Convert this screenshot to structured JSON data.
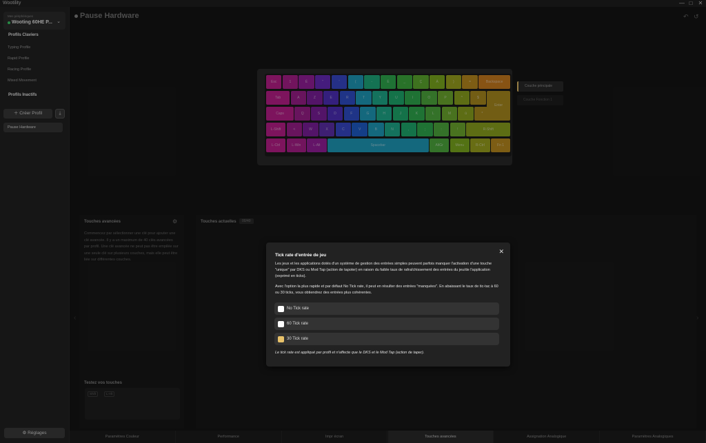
{
  "window": {
    "title": "Wootility",
    "controls": [
      "—",
      "□",
      "✕"
    ]
  },
  "sidebar": {
    "device_label": "Mes périphériques",
    "device_name": "Wooting 60HE P...",
    "keyboard_profiles_title": "Profils Claviers",
    "profiles": [
      "Typing Profile",
      "Rapid Profile",
      "Racing Profile",
      "Mixed Movement"
    ],
    "inactive_title": "Profils Inactifs",
    "create_label": "Créer Profil",
    "inactive_profiles": [
      "Pause Hardware"
    ],
    "settings_label": "Réglages"
  },
  "main": {
    "title": "Pause Hardware",
    "layers": [
      "Couche principale",
      "Couche Fonction 1"
    ],
    "advanced_title": "Touches avancées",
    "advanced_desc": "Commencez par sélectionner une clé pour ajouter une clé avancée. Il y a un maximum de 40 clés avancées par profil. Une clé avancée ne peut pas être empilée sur une seule clé sur plusieurs couches, mais elle peut être liée sur différentes couches.",
    "current_title": "Touches actuelles",
    "current_count": "00/40",
    "test_title": "Testez vos touches",
    "test_keys": [
      "Shift",
      "L-Alt"
    ]
  },
  "keyboard": {
    "rows": [
      [
        [
          "Esc",
          "#c02090"
        ],
        [
          "1",
          "#b02090"
        ],
        [
          "É",
          "#9a20a0"
        ],
        [
          "\"",
          "#6a2cc0"
        ],
        [
          "'",
          "#3a4ad0"
        ],
        [
          "(",
          "#20a0c0"
        ],
        [
          "-",
          "#20b080"
        ],
        [
          "È",
          "#30b050"
        ],
        [
          "_",
          "#40b040"
        ],
        [
          "Ç",
          "#60b030"
        ],
        [
          "À",
          "#80b020"
        ],
        [
          ")",
          "#a0a820"
        ],
        [
          "=",
          "#c09020"
        ],
        [
          "Backspace",
          "#d08020"
        ]
      ],
      [
        [
          "Tab",
          "#c02090"
        ],
        [
          "A",
          "#a02090"
        ],
        [
          "Z",
          "#8020a0"
        ],
        [
          "E",
          "#5030c0"
        ],
        [
          "R",
          "#3050d0"
        ],
        [
          "T",
          "#20a0c0"
        ],
        [
          "Y",
          "#20b090"
        ],
        [
          "U",
          "#20b070"
        ],
        [
          "I",
          "#30b050"
        ],
        [
          "O",
          "#50b040"
        ],
        [
          "P",
          "#70b030"
        ],
        [
          "^",
          "#90a820"
        ],
        [
          "$",
          "#b09020"
        ]
      ],
      [
        [
          "Caps",
          "#c02090"
        ],
        [
          "Q",
          "#a02090"
        ],
        [
          "S",
          "#8020a0"
        ],
        [
          "D",
          "#5030c0"
        ],
        [
          "F",
          "#3050d0"
        ],
        [
          "G",
          "#20a0c0"
        ],
        [
          "H",
          "#20b090"
        ],
        [
          "J",
          "#20b070"
        ],
        [
          "K",
          "#30b050"
        ],
        [
          "L",
          "#50b040"
        ],
        [
          "M",
          "#70b030"
        ],
        [
          "ù",
          "#90a820"
        ],
        [
          "*",
          "#b09020"
        ]
      ],
      [
        [
          "L-Shift",
          "#c02090"
        ],
        [
          "<",
          "#a02090"
        ],
        [
          "W",
          "#8020a0"
        ],
        [
          "X",
          "#6030b0"
        ],
        [
          "C",
          "#3a4ad0"
        ],
        [
          "V",
          "#2060d0"
        ],
        [
          "B",
          "#20a0c0"
        ],
        [
          "N",
          "#20b090"
        ],
        [
          ",",
          "#20b070"
        ],
        [
          ";",
          "#30b050"
        ],
        [
          ":",
          "#50b040"
        ],
        [
          "!",
          "#70b030"
        ],
        [
          "R-Shift",
          "#90a820"
        ]
      ],
      [
        [
          "L-Ctrl",
          "#c02090"
        ],
        [
          "L-Win",
          "#b02090"
        ],
        [
          "L-Alt",
          "#9a20a0"
        ],
        [
          "Spacebar",
          "#20a0c0"
        ],
        [
          "AltGr",
          "#50b040"
        ],
        [
          "Menu",
          "#80b020"
        ],
        [
          "R-Ctrl",
          "#a0a820"
        ],
        [
          "Fn 1",
          "#c09020"
        ]
      ]
    ],
    "enter_label": "Enter",
    "enter_color": "#b09020"
  },
  "tabs": [
    "Paramètres Couleur",
    "Performance",
    "Impr écran",
    "Touches avancées",
    "Assignation Analogique",
    "Paramètres Analogiques"
  ],
  "active_tab": "Touches avancées",
  "modal": {
    "title": "Tick rate d'entrée de jeu",
    "paragraph1": "Les jeux et les applications dotés d'un système de gestion des entrées simples peuvent parfois manquer l'activation d'une touche \"unique\" par DKS ou Mod Tap (action de tapoter) en raison du faible taux de rafraîchissement des entrées du jeu/de l'application (exprimé en ticks).",
    "paragraph2": "Avec l'option la plus rapide et par défaut No Tick rate, il peut en résulter des entrées \"manquées\". En abaissant le taux de tic-tac à 60 ou 30 ticks, vous obtiendrez des entrées plus cohérentes.",
    "options": [
      {
        "label": "No Tick rate",
        "selected": false
      },
      {
        "label": "60 Tick rate",
        "selected": false
      },
      {
        "label": "30 Tick rate",
        "selected": true
      }
    ],
    "footer": "Le tick rate est appliqué par profil et n'affecte que le DKS et le Mod Tap (action de taper)."
  },
  "colors": {
    "accent": "#e8c26a",
    "online": "#3dd66b",
    "background": "#151515"
  }
}
